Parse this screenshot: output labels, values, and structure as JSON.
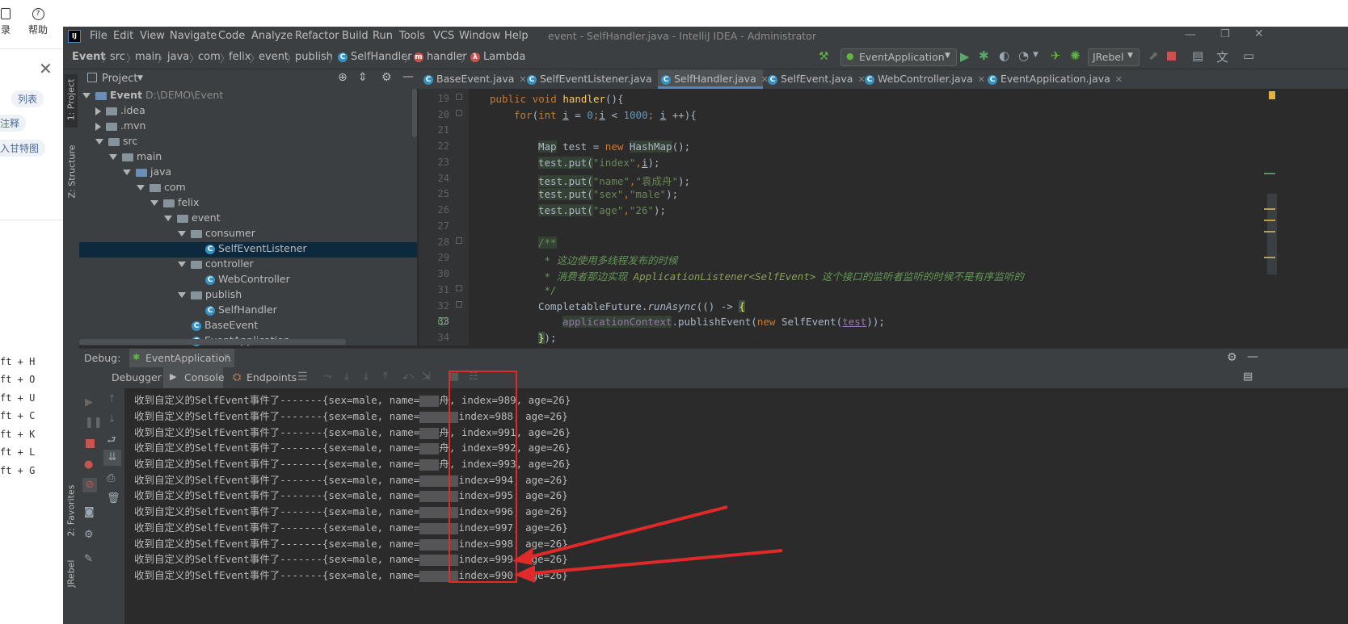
{
  "left_app": {
    "tool_labels": [
      "录",
      "帮助"
    ],
    "chips": [
      "列表",
      "注释",
      "入甘特图"
    ],
    "shortcuts": [
      "ft + H",
      "ft + O",
      "ft + U",
      "ft + C",
      "ft + K",
      "ft + L",
      "ft + G"
    ]
  },
  "window": {
    "title": "event - SelfHandler.java - IntelliJ IDEA - Administrator",
    "menus": [
      "File",
      "Edit",
      "View",
      "Navigate",
      "Code",
      "Analyze",
      "Refactor",
      "Build",
      "Run",
      "Tools",
      "VCS",
      "Window",
      "Help"
    ]
  },
  "breadcrumb": [
    "Event",
    "src",
    "main",
    "java",
    "com",
    "felix",
    "event",
    "publish",
    "SelfHandler",
    "handler",
    "Lambda"
  ],
  "run_config": {
    "name": "EventApplication",
    "jrebel": "JRebel"
  },
  "project_panel": {
    "title": "Project",
    "tree": [
      {
        "label": "Event",
        "extra": "D:\\DEMO\\Event"
      },
      {
        "label": ".idea"
      },
      {
        "label": ".mvn"
      },
      {
        "label": "src"
      },
      {
        "label": "main"
      },
      {
        "label": "java"
      },
      {
        "label": "com"
      },
      {
        "label": "felix"
      },
      {
        "label": "event"
      },
      {
        "label": "consumer"
      },
      {
        "label": "SelfEventListener"
      },
      {
        "label": "controller"
      },
      {
        "label": "WebController"
      },
      {
        "label": "publish"
      },
      {
        "label": "SelfHandler"
      },
      {
        "label": "BaseEvent"
      },
      {
        "label": "EventApplication"
      }
    ]
  },
  "side_labels": {
    "project": "1: Project",
    "structure": "Z: Structure",
    "favorites": "2: Favorites",
    "jrebel": "JRebel"
  },
  "editor_tabs": [
    "BaseEvent.java",
    "SelfEventListener.java",
    "SelfHandler.java",
    "SelfEvent.java",
    "WebController.java",
    "EventApplication.java"
  ],
  "line_numbers": [
    "19",
    "20",
    "21",
    "22",
    "23",
    "24",
    "25",
    "26",
    "27",
    "28",
    "29",
    "30",
    "31",
    "32",
    "33",
    "34"
  ],
  "code": {
    "l19a": "public void ",
    "l19b": "handler",
    "l19c": "(){",
    "l20a": "for",
    "l20b": "(",
    "l20c": "int ",
    "l20d": "i",
    "l20e": " = ",
    "l20f": "0",
    "l20g": ";",
    "l20h": "i",
    "l20i": " < ",
    "l20j": "1000",
    "l20k": "; ",
    "l20l": "i",
    "l20m": " ++){",
    "l22a": "Map",
    "l22b": " test = ",
    "l22c": "new ",
    "l22d": "HashMap",
    "l22e": "();",
    "l23a": "test.put(",
    "l23b": "\"index\"",
    "l23c": ",",
    "l23d": "i",
    "l23e": ");",
    "l24a": "test.put(",
    "l24b": "\"name\"",
    "l24c": ",",
    "l24d": "\"袁成舟\"",
    "l24e": ");",
    "l25a": "test.put(",
    "l25b": "\"sex\"",
    "l25c": ",",
    "l25d": "\"male\"",
    "l25e": ");",
    "l26a": "test.put(",
    "l26b": "\"age\"",
    "l26c": ",",
    "l26d": "\"26\"",
    "l26e": ");",
    "l28": "/**",
    "l29": " * 这边使用多线程发布的时候",
    "l30a": " * 消费者那边实现 ",
    "l30b": "ApplicationListener<SelfEvent>",
    "l30c": " 这个接口的监听者监听的时候不是有序监听的",
    "l31": " */",
    "l32a": "CompletableFuture.",
    "l32b": "runAsync",
    "l32c": "(() -> ",
    "l32d": "{",
    "l33a": "applicationContext",
    "l33b": ".publishEvent(",
    "l33c": "new ",
    "l33d": "SelfEvent(",
    "l33e": "test",
    "l33f": "));",
    "l34a": "}",
    "l34b": ");"
  },
  "debug": {
    "label": "Debug:",
    "config": "EventApplication",
    "tabs": [
      "Debugger",
      "Console",
      "Endpoints"
    ]
  },
  "console_lines": [
    {
      "prefix": "收到自定义的SelfEvent事件了-------{sex=male, name=",
      "suffix": "舟, ",
      "index": "index=989",
      "rest": ", age=26}"
    },
    {
      "prefix": "收到自定义的SelfEvent事件了-------{sex=male, name=",
      "suffix": "",
      "index": "index=988",
      "rest": ", age=26}"
    },
    {
      "prefix": "收到自定义的SelfEvent事件了-------{sex=male, name=",
      "suffix": "舟, ",
      "index": "index=991",
      "rest": ", age=26}"
    },
    {
      "prefix": "收到自定义的SelfEvent事件了-------{sex=male, name=",
      "suffix": "舟, ",
      "index": "index=992",
      "rest": ", age=26}"
    },
    {
      "prefix": "收到自定义的SelfEvent事件了-------{sex=male, name=",
      "suffix": "舟, ",
      "index": "index=993",
      "rest": ", age=26}"
    },
    {
      "prefix": "收到自定义的SelfEvent事件了-------{sex=male, name=",
      "suffix": "",
      "index": "index=994",
      "rest": ", age=26}"
    },
    {
      "prefix": "收到自定义的SelfEvent事件了-------{sex=male, name=",
      "suffix": "",
      "index": "index=995",
      "rest": ", age=26}"
    },
    {
      "prefix": "收到自定义的SelfEvent事件了-------{sex=male, name=",
      "suffix": "",
      "index": "index=996",
      "rest": ", age=26}"
    },
    {
      "prefix": "收到自定义的SelfEvent事件了-------{sex=male, name=",
      "suffix": "",
      "index": "index=997",
      "rest": ", age=26}"
    },
    {
      "prefix": "收到自定义的SelfEvent事件了-------{sex=male, name=",
      "suffix": "",
      "index": "index=998",
      "rest": ", age=26}"
    },
    {
      "prefix": "收到自定义的SelfEvent事件了-------{sex=male, name=",
      "suffix": "",
      "index": "index=999",
      "rest": ", age=26}"
    },
    {
      "prefix": "收到自定义的SelfEvent事件了-------{sex=male, name=",
      "suffix": "",
      "index": "index=990",
      "rest": ", age=26}"
    }
  ],
  "colors": {
    "highlight_box": "#e02a2a",
    "arrow": "#e02a2a",
    "selection": "#0d293e"
  }
}
